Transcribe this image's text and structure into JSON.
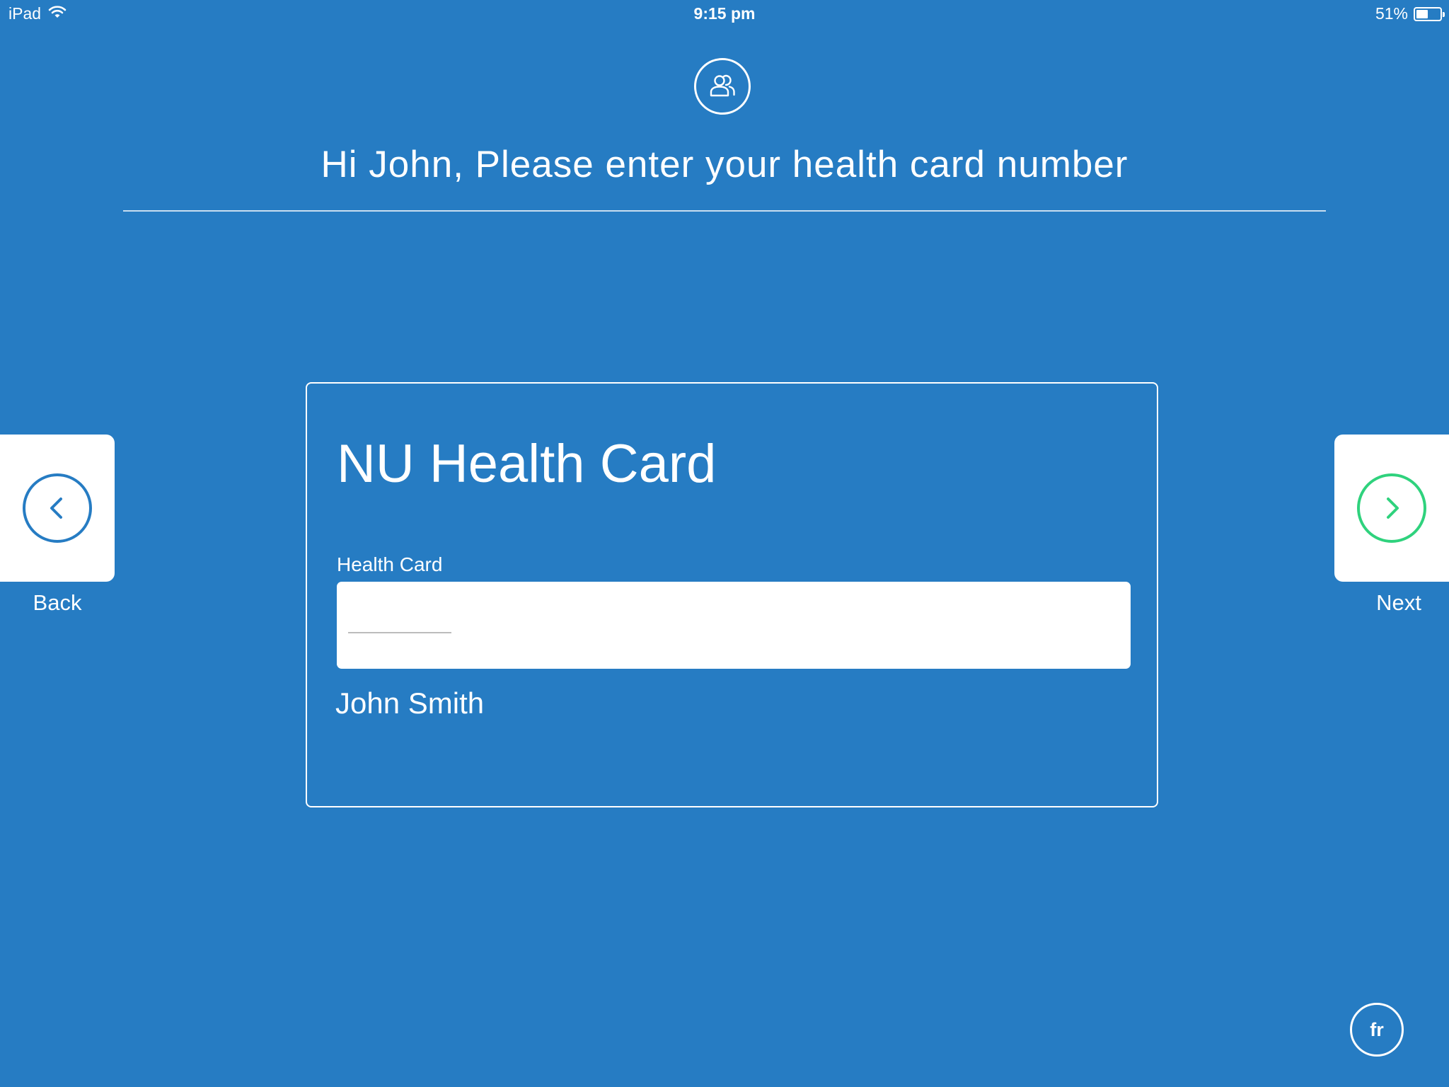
{
  "status_bar": {
    "device": "iPad",
    "time": "9:15 pm",
    "battery": "51%",
    "battery_level": 0.51
  },
  "header": {
    "icon": "users-icon",
    "title": "Hi John, Please enter your health card number"
  },
  "card": {
    "title": "NU Health Card",
    "field_label": "Health Card",
    "field_value": "",
    "patient_name": "John Smith"
  },
  "nav": {
    "back_label": "Back",
    "next_label": "Next",
    "back_icon": "chevron-left-icon",
    "next_icon": "chevron-right-icon"
  },
  "language": {
    "label": "fr"
  },
  "colors": {
    "background": "#267cc3",
    "next_accent": "#2fd27d",
    "text": "#ffffff"
  }
}
